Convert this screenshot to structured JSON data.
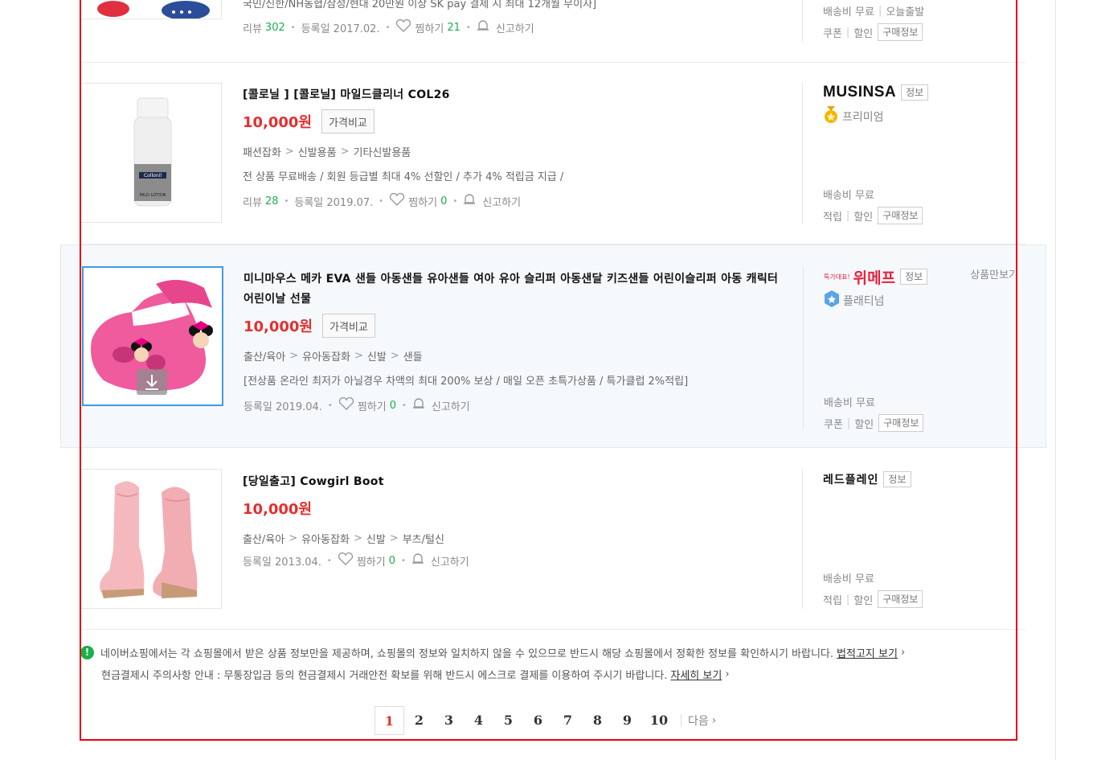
{
  "partial_item": {
    "title_cut": "국민/신한/NH농협/삼성/현대 20만원 이상 SK pay 결제 시 최대 12개월 무이자]",
    "review_label": "리뷰",
    "review_count": "302",
    "date": "등록일 2017.02.",
    "like_label": "찜하기",
    "like_count": "21",
    "report_label": "신고하기",
    "shipping": "배송비 무료",
    "ship_extra": "오늘출발",
    "coupon": "쿠폰",
    "discount": "할인",
    "buy_info": "구매정보"
  },
  "items": [
    {
      "title": "[콜로닐 ] [콜로닐] 마일드클리너 COL26",
      "price": "10,000원",
      "compare_label": "가격비교",
      "categories": [
        "패션잡화",
        "신발용품",
        "기타신발용품"
      ],
      "desc": "전 상품 무료배송 / 회원 등급별 최대 4% 선할인 / 추가 4% 적립금 지급 /",
      "review_label": "리뷰",
      "review_count": "28",
      "date": "등록일 2019.07.",
      "like_label": "찜하기",
      "like_count": "0",
      "report_label": "신고하기",
      "seller_logo": "MUSINSA",
      "info_label": "정보",
      "grade": "프리미엄",
      "shipping": "배송비 무료",
      "coupon": "적립",
      "discount": "할인",
      "buy_info": "구매정보"
    },
    {
      "title": "미니마우스 메카 EVA 샌들 아동샌들 유아샌들 여아 유아 슬리퍼 아동샌달 키즈샌들 어린이슬리퍼 아동 캐릭터 어린이날 선물",
      "price": "10,000원",
      "compare_label": "가격비교",
      "categories": [
        "출산/육아",
        "유아동잡화",
        "신발",
        "샌들"
      ],
      "desc": "[전상품 온라인 최저가 아닐경우 차액의 최대 200% 보상 / 매일 오픈 초특가상품 / 특가클럽 2%적립]",
      "date": "등록일 2019.04.",
      "like_label": "찜하기",
      "like_count": "0",
      "report_label": "신고하기",
      "seller_logo_small": "특가대표!",
      "seller_logo": "위메프",
      "info_label": "정보",
      "grade": "플래티넘",
      "compare_only": "상품만보기",
      "shipping": "배송비 무료",
      "coupon": "쿠폰",
      "discount": "할인",
      "buy_info": "구매정보"
    },
    {
      "title": "[당일출고] Cowgirl Boot",
      "price": "10,000원",
      "categories": [
        "출산/육아",
        "유아동잡화",
        "신발",
        "부츠/털신"
      ],
      "date": "등록일 2013.04.",
      "like_label": "찜하기",
      "like_count": "0",
      "report_label": "신고하기",
      "seller_name": "레드플레인",
      "info_label": "정보",
      "shipping": "배송비 무료",
      "coupon": "적립",
      "discount": "할인",
      "buy_info": "구매정보"
    }
  ],
  "notice": {
    "line1": "네이버쇼핑에서는 각 쇼핑몰에서 받은 상품 정보만을 제공하며, 쇼핑몰의 정보와 일치하지 않을 수 있으므로 반드시 해당 쇼핑몰에서 정확한 정보를 확인하시기 바랍니다.",
    "link1": "법적고지 보기",
    "line2": "현금결제시 주의사항 안내 : 무통장입금 등의 현금결제시 거래안전 확보를 위해 반드시 에스크로 결제를 이용하여 주시기 바랍니다.",
    "link2": "자세히 보기"
  },
  "pagination": {
    "pages": [
      "1",
      "2",
      "3",
      "4",
      "5",
      "6",
      "7",
      "8",
      "9",
      "10"
    ],
    "current": "1",
    "next_label": "다음"
  },
  "colors": {
    "price": "#e62e2e",
    "count": "#19b04b",
    "selected_border": "#3d9be9",
    "frame": "#e60012"
  }
}
